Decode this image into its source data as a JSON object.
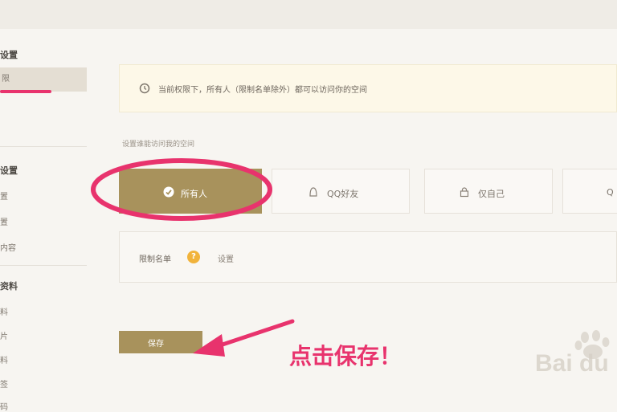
{
  "sidebar": {
    "group1": "设置",
    "item_active": "限",
    "item2": "",
    "group2": "设置",
    "group2_items": [
      "置",
      "置",
      "内容"
    ],
    "group3": "资料",
    "group3_items": [
      "料",
      "片",
      "料",
      "签",
      "码"
    ]
  },
  "banner": {
    "text": "当前权限下，所有人（限制名单除外）都可以访问你的空间",
    "icon": "clock-icon"
  },
  "section_label": "设置谁能访问我的空间",
  "options": [
    {
      "label": "所有人",
      "icon": "check-circle-icon",
      "selected": true
    },
    {
      "label": "QQ好友",
      "icon": "user-icon",
      "selected": false
    },
    {
      "label": "仅自己",
      "icon": "lock-icon",
      "selected": false
    },
    {
      "label": "Q",
      "icon": "",
      "selected": false
    }
  ],
  "whitelist": {
    "title": "限制名单",
    "badge": "?",
    "link": "设置"
  },
  "save_button": "保存",
  "annotation": "点击保存！",
  "watermark": "Bai du",
  "colors": {
    "accent": "#a8925c",
    "annotation": "#e8336d",
    "banner_bg": "#fdf8e8"
  }
}
